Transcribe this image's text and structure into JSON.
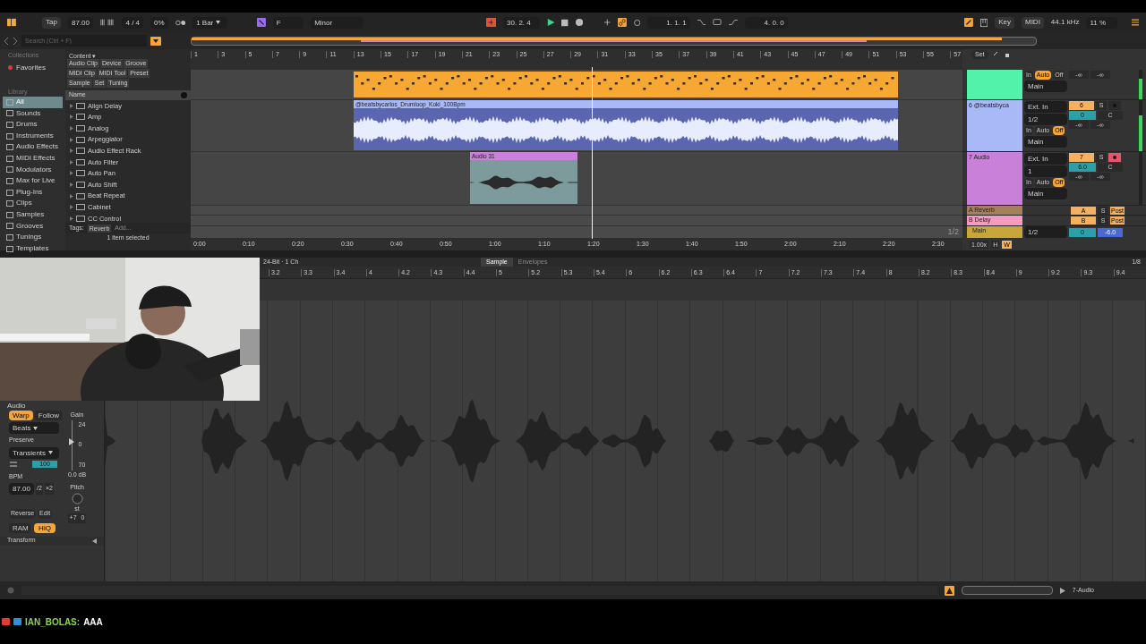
{
  "control_bar": {
    "tap": "Tap",
    "tempo": "87.00",
    "signature": "4 / 4",
    "swing": "0%",
    "quantize": "1 Bar",
    "key": "F",
    "scale": "Minor",
    "position": "30. 2. 4",
    "loop_start": "1. 1. 1",
    "loop_length": "4. 0. 0",
    "key_map": "Key",
    "midi_map": "MIDI",
    "sample_rate": "44.1 kHz",
    "cpu": "11 %"
  },
  "browser": {
    "search_placeholder": "Search (Ctrl + F)",
    "collections_heading": "Collections",
    "favorites": "Favorites",
    "library_heading": "Library",
    "library_items": [
      {
        "label": "All",
        "selected": true
      },
      {
        "label": "Sounds",
        "selected": false
      },
      {
        "label": "Drums",
        "selected": false
      },
      {
        "label": "Instruments",
        "selected": false
      },
      {
        "label": "Audio Effects",
        "selected": false
      },
      {
        "label": "MIDI Effects",
        "selected": false
      },
      {
        "label": "Modulators",
        "selected": false
      },
      {
        "label": "Max for Live",
        "selected": false
      },
      {
        "label": "Plug-Ins",
        "selected": false
      },
      {
        "label": "Clips",
        "selected": false
      },
      {
        "label": "Samples",
        "selected": false
      },
      {
        "label": "Grooves",
        "selected": false
      },
      {
        "label": "Tunings",
        "selected": false
      },
      {
        "label": "Templates",
        "selected": false
      }
    ],
    "content_heading": "Content ▾",
    "content_filters": [
      "Audio Clip",
      "Device",
      "Groove",
      "MIDI Clip",
      "MIDI Tool",
      "Preset",
      "Sample",
      "Set",
      "Tuning"
    ],
    "name_column": "Name",
    "items": [
      "Align Delay",
      "Amp",
      "Analog",
      "Arpeggiator",
      "Audio Effect Rack",
      "Auto Filter",
      "Auto Pan",
      "Auto Shift",
      "Beat Repeat",
      "Cabinet",
      "CC Control"
    ],
    "tags_label": "Tags:",
    "tag": "Reverb",
    "tag_placeholder": "Add...",
    "status": "1 item selected"
  },
  "arrangement": {
    "ruler": [
      "1",
      "3",
      "5",
      "7",
      "9",
      "11",
      "13",
      "15",
      "17",
      "19",
      "21",
      "23",
      "25",
      "27",
      "29",
      "31",
      "33",
      "35",
      "37",
      "39",
      "41",
      "43",
      "45",
      "47",
      "49",
      "51",
      "53",
      "55",
      "57"
    ],
    "tracks": [
      {
        "kind": "midi",
        "color": "#f6a833"
      },
      {
        "kind": "audio",
        "clip": "@beatsbycarlos_Drumloop_Koki_100Bpm",
        "color": "#a9b8f7"
      },
      {
        "kind": "audio",
        "clip": "Audio 31",
        "color": "#c880d8"
      }
    ],
    "zoom_label": "1/2",
    "time_ruler": [
      "0:00",
      "0:10",
      "0:20",
      "0:30",
      "0:40",
      "0:50",
      "1:00",
      "1:10",
      "1:20",
      "1:30",
      "1:40",
      "1:50",
      "2:00",
      "2:10",
      "2:20",
      "2:30"
    ]
  },
  "mixer": {
    "set": "Set",
    "tracks": [
      {
        "color": "#52f2aa",
        "monitor": [
          {
            "label": "In",
            "selected": false
          },
          {
            "label": "Auto",
            "selected": true
          },
          {
            "label": "Off",
            "selected": false
          }
        ],
        "output": "Main",
        "peaks": [
          "-∞",
          "-∞"
        ]
      },
      {
        "name": "6 @beatsbyca",
        "color": "#a9b8f7",
        "input": "Ext. In",
        "channel": "1/2",
        "monitor": [
          {
            "label": "In",
            "selected": false
          },
          {
            "label": "Auto",
            "selected": false
          },
          {
            "label": "Off",
            "selected": true
          }
        ],
        "output": "Main",
        "number": "6",
        "solo": "S",
        "armed": false,
        "volume": "0",
        "pan": "C",
        "peaks": [
          "-∞",
          "-∞"
        ]
      },
      {
        "name": "7 Audio",
        "color": "#c880d8",
        "input": "Ext. In",
        "channel": "1",
        "monitor": [
          {
            "label": "In",
            "selected": false
          },
          {
            "label": "Auto",
            "selected": false
          },
          {
            "label": "Off",
            "selected": true
          }
        ],
        "output": "Main",
        "number": "7",
        "solo": "S",
        "armed": true,
        "volume": "6.0",
        "pan": "C",
        "peaks": [
          "-∞",
          "-∞"
        ]
      }
    ],
    "returns": [
      {
        "name": "A Reverb",
        "color": "#a57f5e",
        "letter": "A",
        "solo": "S",
        "send": "Post"
      },
      {
        "name": "B Delay",
        "color": "#f59ac0",
        "letter": "B",
        "solo": "S",
        "send": "Post"
      }
    ],
    "main": {
      "name": "Main",
      "color": "#c9a63a",
      "channel": "1/2",
      "volume": "0",
      "pan": "-6.0"
    },
    "footer": {
      "speed": "1.00x",
      "h": "H",
      "w": "W"
    }
  },
  "detail": {
    "format": "24-Bit · 1 Ch",
    "tabs": [
      {
        "label": "Sample",
        "selected": true
      },
      {
        "label": "Envelopes",
        "selected": false
      }
    ],
    "zoom": "1/8",
    "ruler": [
      "3.2",
      "3.3",
      "3.4",
      "4",
      "4.2",
      "4.3",
      "4.4",
      "5",
      "5.2",
      "5.3",
      "5.4",
      "6",
      "6.2",
      "6.3",
      "6.4",
      "7",
      "7.2",
      "7.3",
      "7.4",
      "8",
      "8.2",
      "8.3",
      "8.4",
      "9",
      "9.2",
      "9.3",
      "9.4"
    ]
  },
  "clip": {
    "heading": "Audio",
    "warp": {
      "label": "Warp",
      "on": true
    },
    "follow": {
      "label": "Follow",
      "on": false
    },
    "warp_mode": "Beats",
    "preserve_label": "Preserve",
    "preserve": "Transients",
    "grain": "100",
    "bpm_label": "BPM",
    "bpm": "87.00",
    "half": "/2",
    "double": "×2",
    "gain_label": "Gain",
    "gain_slider": {
      "level": 0.57
    },
    "gain_scale": [
      "24",
      "0",
      "70"
    ],
    "gain": "0.0 dB",
    "pitch_label": "Pitch",
    "pitch_unit": "st",
    "reverse": "Reverse",
    "edit": "Edit",
    "ram": {
      "label": "RAM",
      "on": false
    },
    "hiq": {
      "label": "HiQ",
      "on": true
    },
    "transpose": "+7",
    "detune": "0",
    "transform": "Transform"
  },
  "status_bar": {
    "track": "7-Audio"
  },
  "chat": {
    "user": "IAN_BOLAS:",
    "message": "AAA"
  }
}
